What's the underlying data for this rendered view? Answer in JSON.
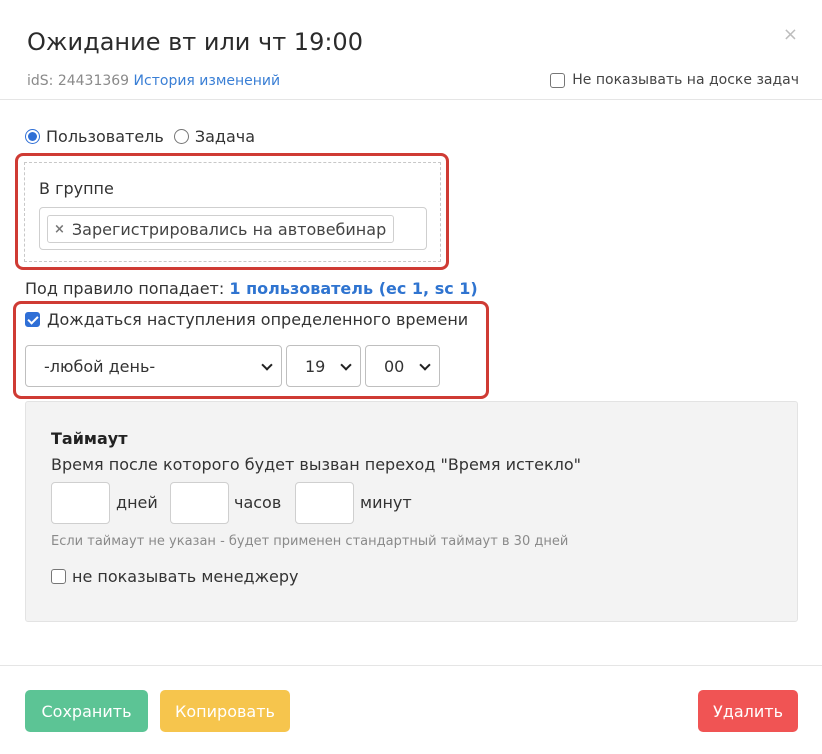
{
  "dialog": {
    "title": "Ожидание вт или чт 19:00",
    "close_symbol": "×",
    "ids_label": "idS: 24431369",
    "history_link": "История изменений",
    "hide_on_board": {
      "label": "Не показывать на доске задач",
      "checked": false
    }
  },
  "target": {
    "options": [
      {
        "label": "Пользователь",
        "selected": true
      },
      {
        "label": "Задача",
        "selected": false
      }
    ]
  },
  "condition": {
    "group_label": "В группе",
    "tags": [
      {
        "remove_symbol": "×",
        "label": "Зарегистрировались на автовебинар"
      }
    ]
  },
  "rule_info": {
    "prefix": "Под правило попадает:",
    "count_link": "1 пользователь (ec 1, sc 1)"
  },
  "wait_time": {
    "checkbox_label": "Дождаться наступления определенного времени",
    "checked": true,
    "day_select": "-любой день-",
    "hour_select": "19",
    "minute_select": "00"
  },
  "timeout": {
    "title": "Таймаут",
    "description": "Время после которого будет вызван переход \"Время истекло\"",
    "days_value": "",
    "days_label": "дней",
    "hours_value": "",
    "hours_label": "часов",
    "minutes_value": "",
    "minutes_label": "минут",
    "hint": "Если таймаут не указан - будет применен стандартный таймаут в 30 дней",
    "hide_from_manager": {
      "label": "не показывать менеджеру",
      "checked": false
    }
  },
  "footer": {
    "save_label": "Сохранить",
    "copy_label": "Копировать",
    "delete_label": "Удалить"
  },
  "colors": {
    "save": "#5cc495",
    "copy": "#f6c54d",
    "delete": "#f05454",
    "highlight": "#cf3b34",
    "link": "#2f74d0"
  },
  "icons": {
    "close": "close-icon",
    "select_arrow": "chevron-down-icon",
    "tag_remove": "remove-icon"
  }
}
